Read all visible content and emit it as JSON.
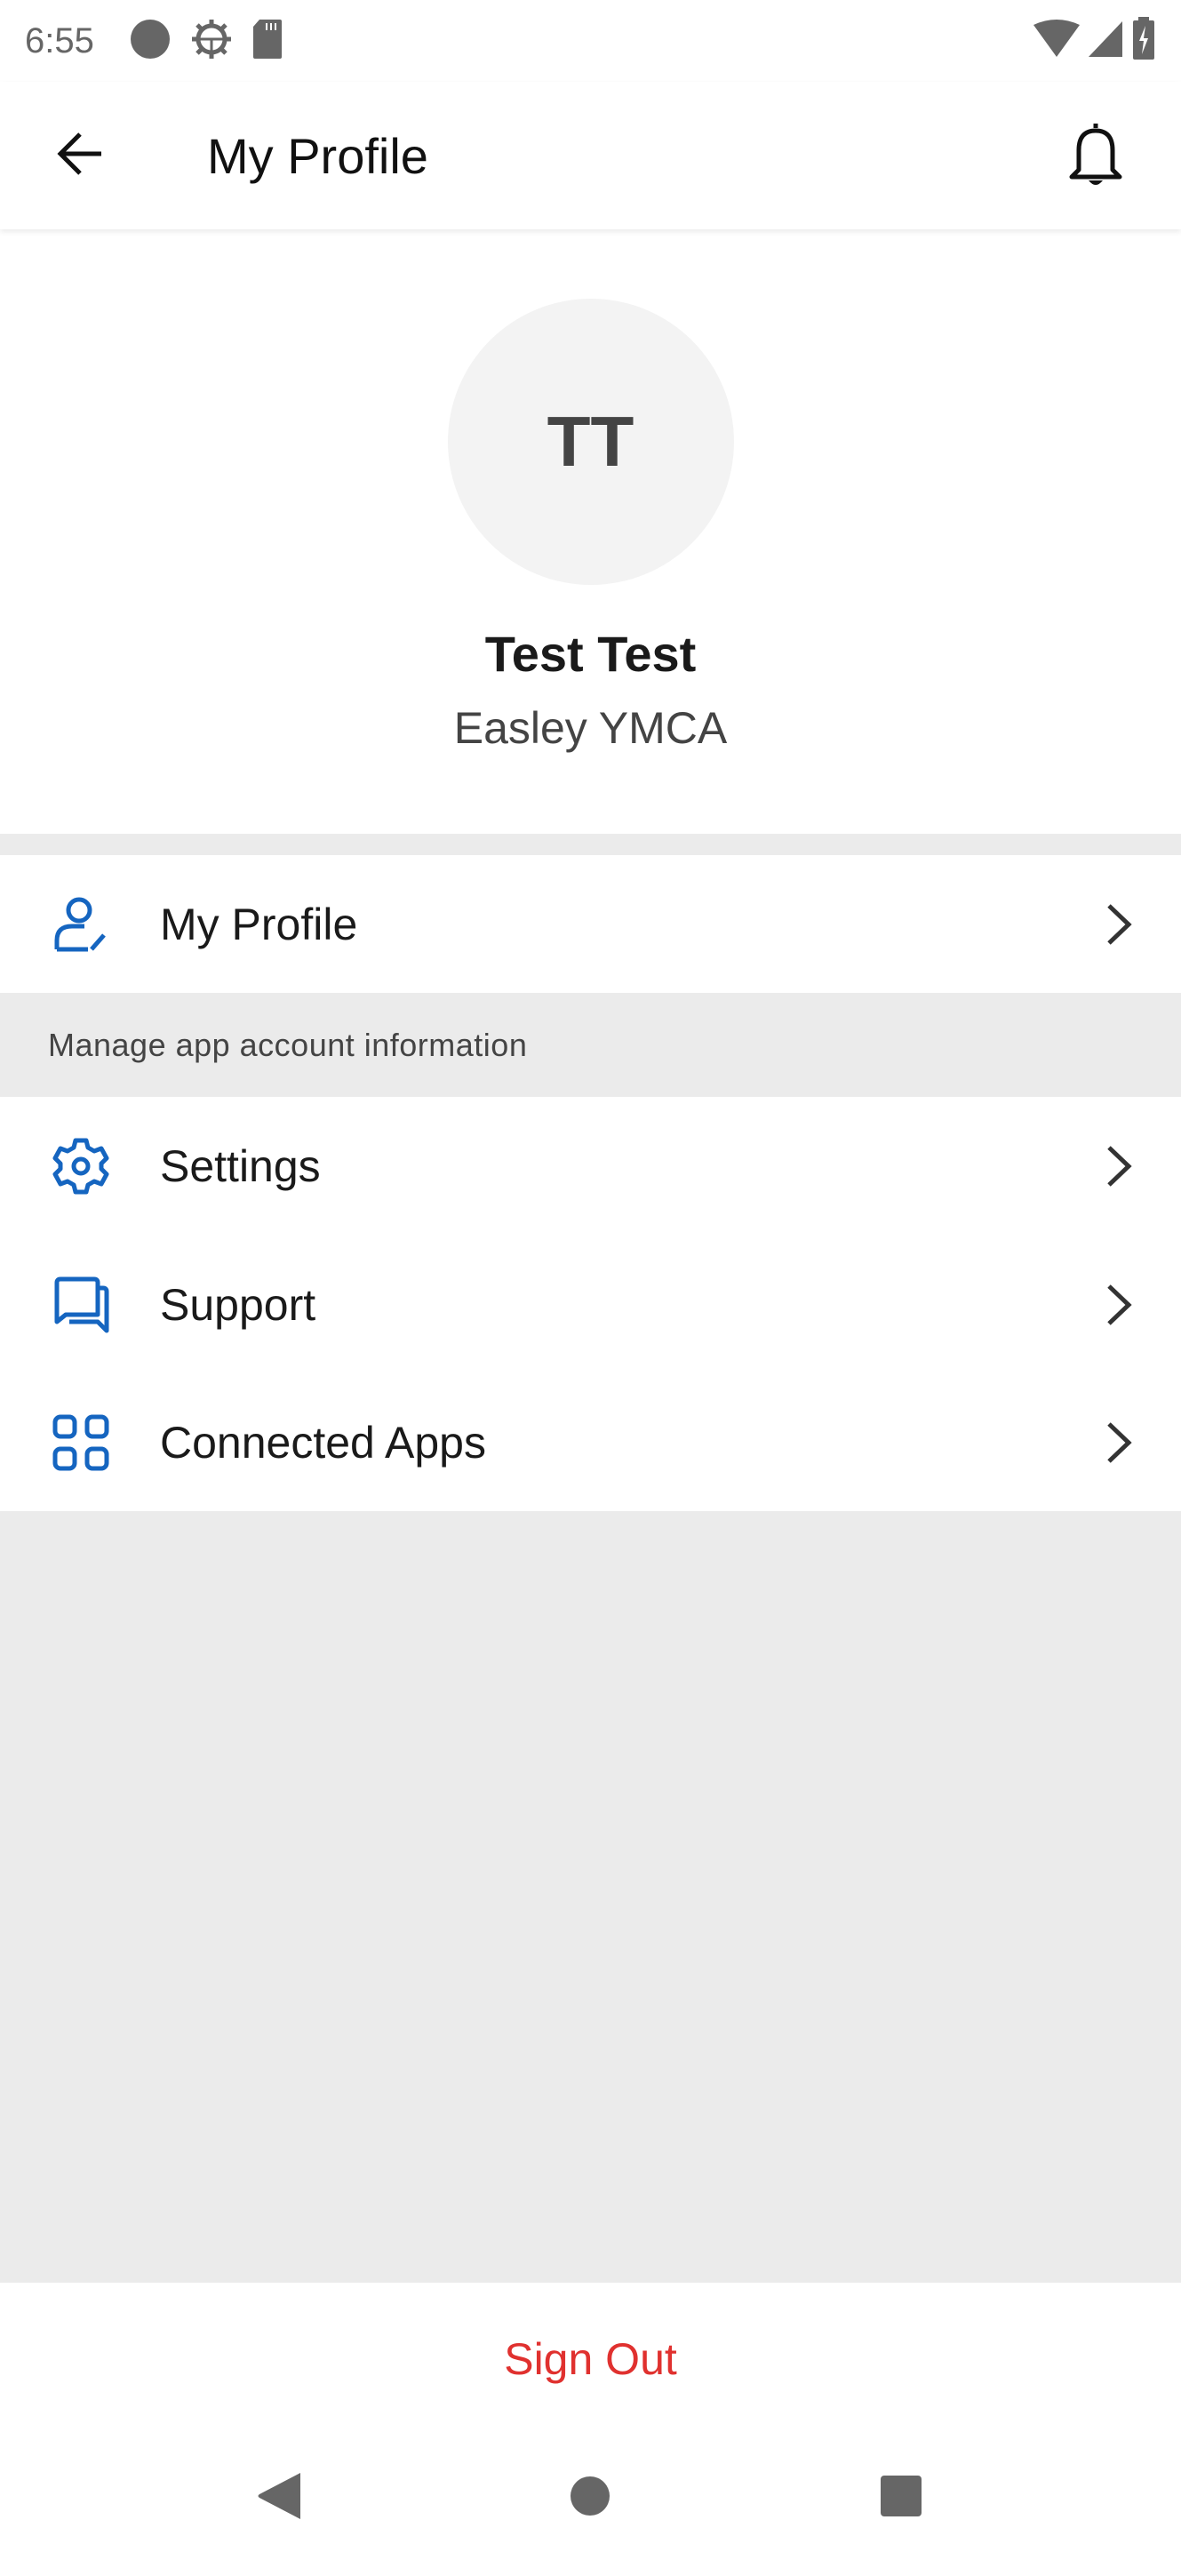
{
  "status_bar": {
    "time": "6:55",
    "left_icons": [
      "notification-dot-icon",
      "android-debug-icon",
      "sd-card-icon"
    ],
    "right_icons": [
      "wifi-icon",
      "cell-signal-icon",
      "battery-charging-icon"
    ]
  },
  "app_bar": {
    "title": "My Profile",
    "back_icon": "arrow-left-icon",
    "notifications_icon": "bell-icon"
  },
  "profile": {
    "initials": "TT",
    "name": "Test Test",
    "organization": "Easley YMCA"
  },
  "menu": {
    "profile_item": {
      "label": "My Profile",
      "icon": "user-edit-icon"
    },
    "caption": "Manage app account information",
    "items": [
      {
        "label": "Settings",
        "icon": "gear-icon"
      },
      {
        "label": "Support",
        "icon": "chat-bubbles-icon"
      },
      {
        "label": "Connected Apps",
        "icon": "grid-apps-icon"
      }
    ]
  },
  "sign_out": {
    "label": "Sign Out"
  },
  "colors": {
    "accent": "#1565c0",
    "danger": "#e0312f",
    "background": "#ebebeb"
  },
  "nav_bar": {
    "buttons": [
      "back-triangle-icon",
      "home-circle-icon",
      "recents-square-icon"
    ]
  }
}
